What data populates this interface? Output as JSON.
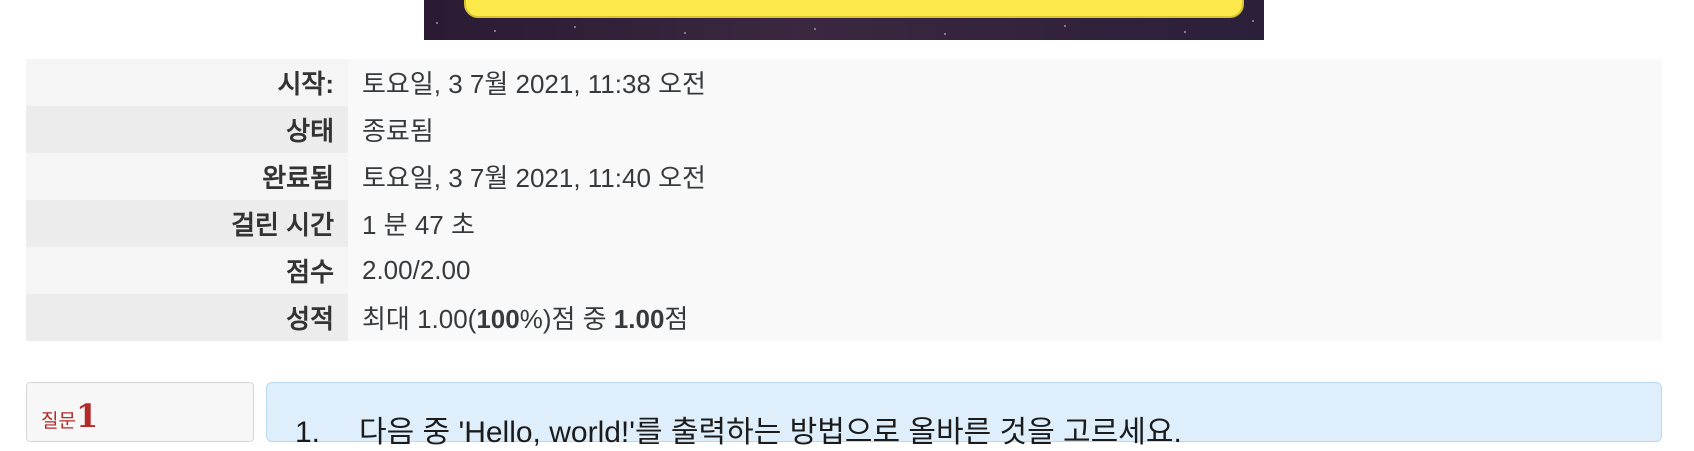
{
  "summary": {
    "rows": [
      {
        "label": "시작:",
        "value": "토요일, 3 7월 2021, 11:38 오전"
      },
      {
        "label": "상태",
        "value": "종료됨"
      },
      {
        "label": "완료됨",
        "value": "토요일, 3 7월 2021, 11:40 오전"
      },
      {
        "label": "걸린 시간",
        "value": "1 분 47 초"
      },
      {
        "label": "점수",
        "value": "2.00/2.00"
      },
      {
        "label": "성적",
        "value_prefix": "최대 1.00(",
        "value_percent": "100",
        "value_mid": "%)점 중 ",
        "value_score": "1.00",
        "value_suffix": "점"
      }
    ]
  },
  "question": {
    "label": "질문",
    "number": "1",
    "index": "1.",
    "text": "다음 중 'Hello, world!'를 출력하는 방법으로 올바른 것을 고르세요."
  },
  "colors": {
    "banner_yellow": "#fde84a",
    "question_red": "#b32a2a",
    "question_bg": "#deeefa"
  }
}
